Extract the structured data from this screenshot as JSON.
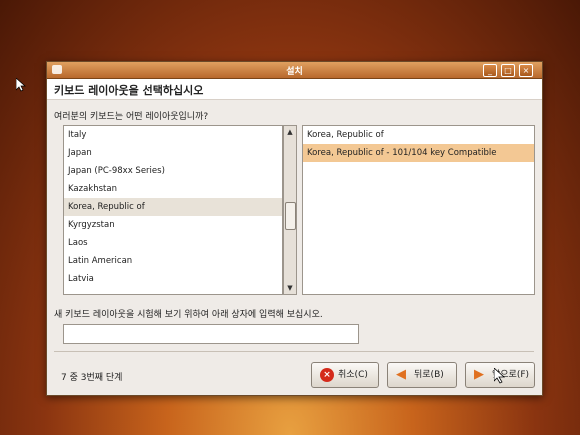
{
  "window": {
    "title": "설치"
  },
  "heading": "키보드 레이아웃을 선택하십시오",
  "question": "여러분의 키보드는 어떤 레이아웃입니까?",
  "layouts": [
    "Italy",
    "Japan",
    "Japan (PC-98xx Series)",
    "Kazakhstan",
    "Korea, Republic of",
    "Kyrgyzstan",
    "Laos",
    "Latin American",
    "Latvia"
  ],
  "selected_layout_index": 4,
  "variants": [
    "Korea, Republic of",
    "Korea, Republic of - 101/104 key Compatible"
  ],
  "selected_variant_index": 1,
  "test_label": "새 키보드 레이아웃을 시험해 보기 위하여 아래 상자에 입력해 보십시오.",
  "test_input_value": "",
  "step": "7 중 3번째 단계",
  "buttons": {
    "cancel": "취소(C)",
    "back": "뒤로(B)",
    "forward": "앞으로(F)"
  },
  "icons": {
    "cancel": "cancel-icon",
    "back": "back-arrow-icon",
    "forward": "forward-arrow-icon"
  },
  "colors": {
    "titlebar": "#c8763a",
    "selection": "#f3c894"
  }
}
